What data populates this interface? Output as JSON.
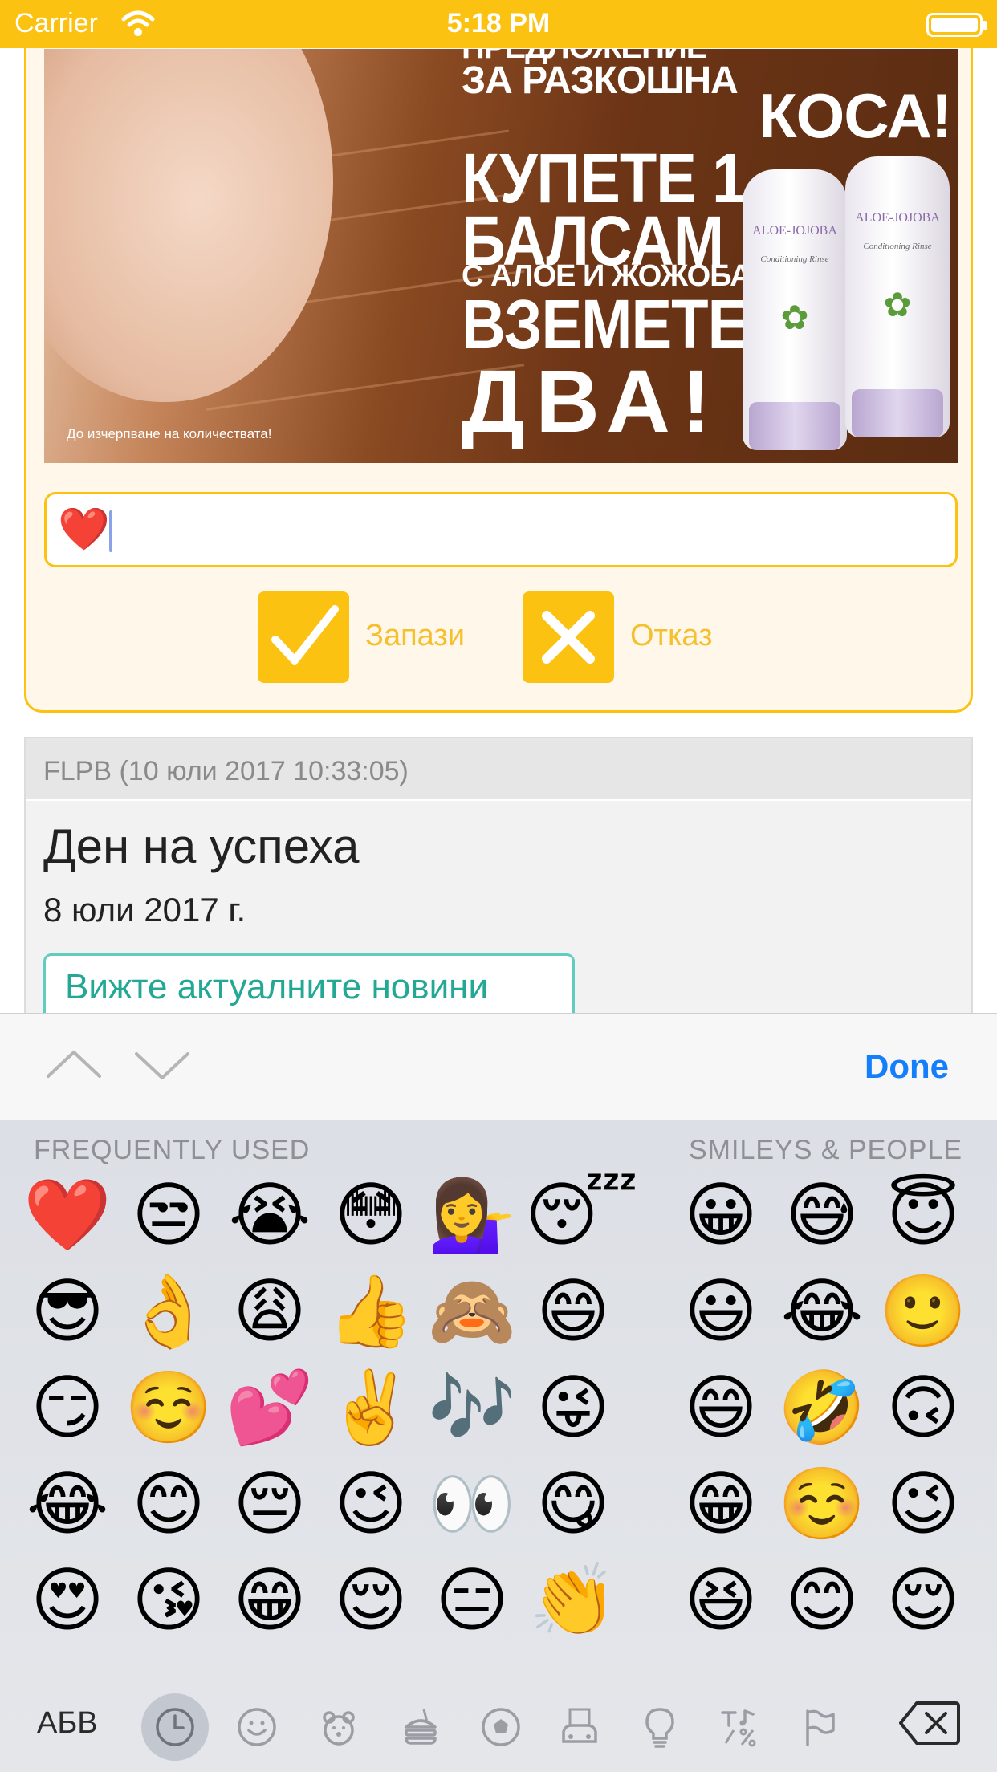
{
  "status_bar": {
    "carrier": "Carrier",
    "time": "5:18 PM"
  },
  "banner": {
    "headline_1": "ПРЕДЛОЖЕНИЕ",
    "headline_2": "ЗА РАЗКОШНА",
    "headline_3": "КОСА!",
    "offer_1": "КУПЕТЕ 1",
    "offer_2": "БАЛСАМ",
    "offer_3": "С АЛОЕ И ЖОЖОБА,",
    "offer_4": "ВЗЕМЕТЕ",
    "offer_5": "ДВА!",
    "footnote": "До изчерпване на количествата!",
    "product_name": "ALOE-JOJOBA",
    "product_sub": "Conditioning Rinse"
  },
  "comment": {
    "value": "❤️"
  },
  "actions": {
    "save_label": "Запази",
    "cancel_label": "Отказ"
  },
  "news": {
    "author_meta": "FLPB (10 юли 2017 10:33:05)",
    "title": "Ден на успеха",
    "date": "8 юли 2017 г.",
    "button_label": "Вижте актуалните новини"
  },
  "keyboard_toolbar": {
    "done_label": "Done",
    "prev_icon": "chevron-up-icon",
    "next_icon": "chevron-down-icon"
  },
  "emoji_keyboard": {
    "sections": {
      "frequent": "FREQUENTLY USED",
      "smileys": "SMILEYS & PEOPLE"
    },
    "frequent_rows": [
      [
        "❤️",
        "😒",
        "😭",
        "😳",
        "💁‍♀️",
        "😴"
      ],
      [
        "😎",
        "👌",
        "😩",
        "👍",
        "🙈",
        "😄"
      ],
      [
        "😏",
        "☺️",
        "💕",
        "✌️",
        "🎶",
        "😜"
      ],
      [
        "😂",
        "😊",
        "😔",
        "😉",
        "👀",
        "😋"
      ],
      [
        "😍",
        "😘",
        "😁",
        "😌",
        "😑",
        "👏"
      ]
    ],
    "smiley_rows": [
      [
        "😀",
        "😅",
        "😇"
      ],
      [
        "😃",
        "😂",
        "🙂"
      ],
      [
        "😄",
        "🤣",
        "🙃"
      ],
      [
        "😁",
        "☺️",
        "😉"
      ],
      [
        "😆",
        "😊",
        "😌"
      ]
    ],
    "abc_label": "АБВ",
    "categories": [
      "recent-icon",
      "smileys-icon",
      "animals-icon",
      "food-icon",
      "activity-icon",
      "travel-icon",
      "objects-icon",
      "symbols-icon",
      "flags-icon"
    ],
    "selected_category": "recent-icon",
    "backspace_icon": "backspace-icon"
  },
  "colors": {
    "accent": "#fcc211",
    "panel_background": "#fff8ea",
    "link_teal": "#22a894",
    "done_blue": "#147efb"
  }
}
